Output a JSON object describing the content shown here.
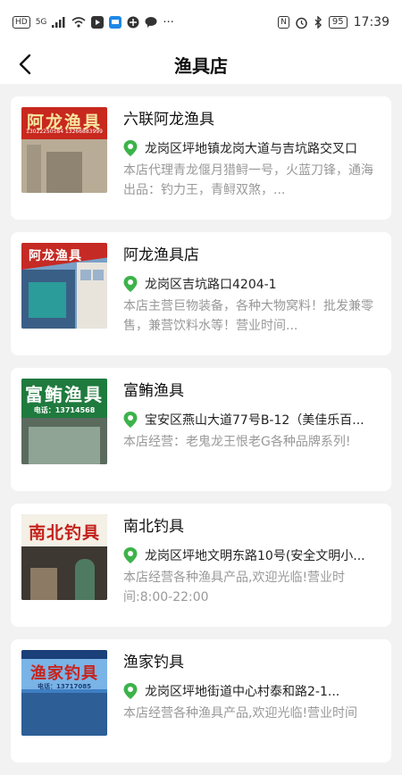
{
  "status_bar": {
    "hd_label": "HD",
    "net_label": "5G",
    "more": "···",
    "nfc": "N",
    "battery": "95",
    "time": "17:39"
  },
  "header": {
    "title": "渔具店"
  },
  "shops": [
    {
      "name": "六联阿龙渔具",
      "address": "龙岗区坪地镇龙岗大道与吉坑路交叉口",
      "description": "本店代理青龙偃月猎鲟一号，火蓝刀锋，通海出品：钓力王，青鲟双煞，...",
      "sign_text": "阿龙渔具",
      "sign_phone": "13022250584 13266883999"
    },
    {
      "name": "阿龙渔具店",
      "address": "龙岗区吉坑路口4204-1",
      "description": "本店主营巨物装备，各种大物窝料！批发兼零售，兼营饮料水等！营业时间...",
      "sign_text": "阿龙渔具"
    },
    {
      "name": "富鲔渔具",
      "address": "宝安区燕山大道77号B-12（美佳乐百...",
      "description": "本店经营：老鬼龙王恨老G各种品牌系列!",
      "sign_text": "富鲔渔具",
      "sign_phone": "电话：13714568"
    },
    {
      "name": "南北钓具",
      "address": "龙岗区坪地文明东路10号(安全文明小...",
      "description": "本店经营各种渔具产品,欢迎光临!营业时间:8:00-22:00",
      "sign_text": "南北钓具"
    },
    {
      "name": "渔家钓具",
      "address": "龙岗区坪地街道中心村泰和路2-1...",
      "description": "本店经营各种渔具产品,欢迎光临!营业时间",
      "sign_text": "渔家钓具",
      "sign_phone": "电话：13717085"
    }
  ],
  "colors": {
    "pin": "#3cb34a",
    "accent_text": "#111111",
    "muted_text": "#999999"
  }
}
